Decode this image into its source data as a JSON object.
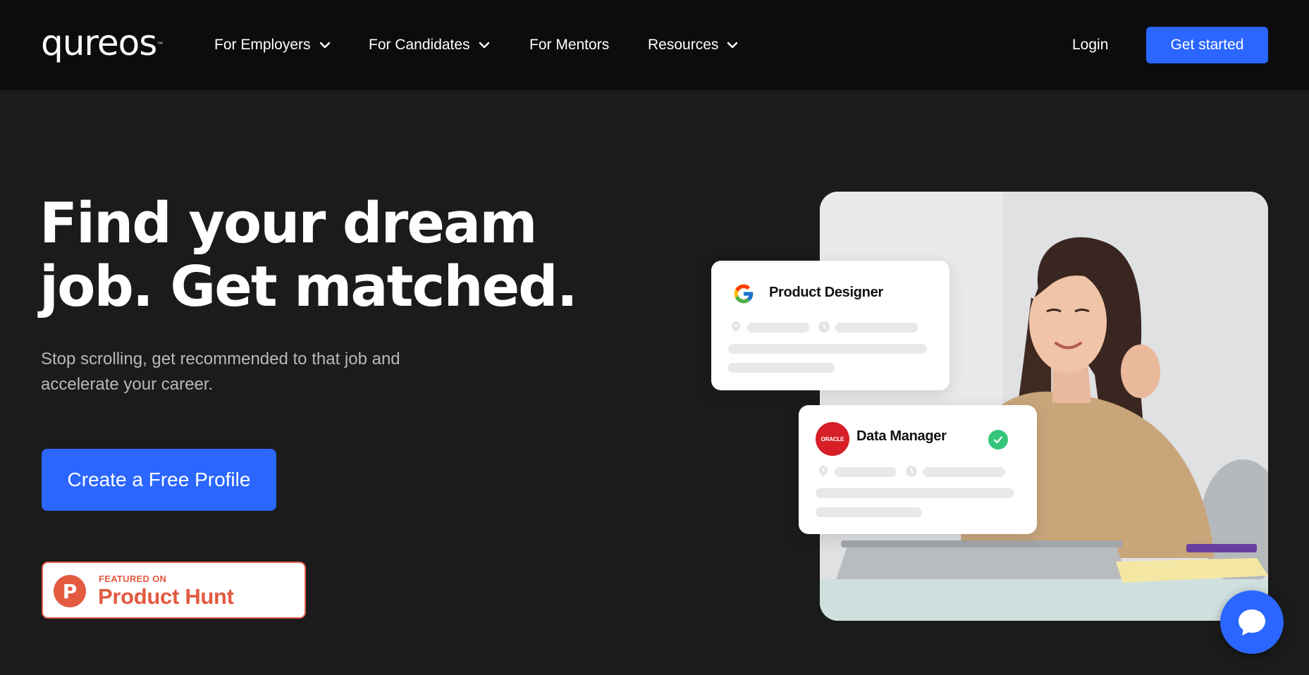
{
  "header": {
    "logo_text": "qureos",
    "logo_mark": "™",
    "nav": [
      {
        "label": "For Employers",
        "has_dropdown": true
      },
      {
        "label": "For Candidates",
        "has_dropdown": true
      },
      {
        "label": "For Mentors",
        "has_dropdown": false
      },
      {
        "label": "Resources",
        "has_dropdown": true
      }
    ],
    "login_label": "Login",
    "get_started_label": "Get started"
  },
  "hero": {
    "title_line1": "Find your dream",
    "title_line2": "job. Get matched.",
    "subtitle_line1": "Stop scrolling, get recommended to that job and",
    "subtitle_line2": "accelerate your career.",
    "cta_label": "Create a Free Profile"
  },
  "product_hunt": {
    "featured_text": "FEATURED ON",
    "name": "Product Hunt",
    "logo_letter": "P"
  },
  "cards": [
    {
      "title": "Product Designer",
      "company_icon": "google-logo-icon",
      "matched": false
    },
    {
      "title": "Data Manager",
      "company_icon": "oracle-logo-icon",
      "company_text": "ORACLE",
      "matched": true
    }
  ],
  "colors": {
    "accent": "#2a66ff",
    "header_bg": "#0c0c0c",
    "page_bg": "#1b1b1b",
    "product_hunt": "#e25a40",
    "success": "#34c77b"
  }
}
